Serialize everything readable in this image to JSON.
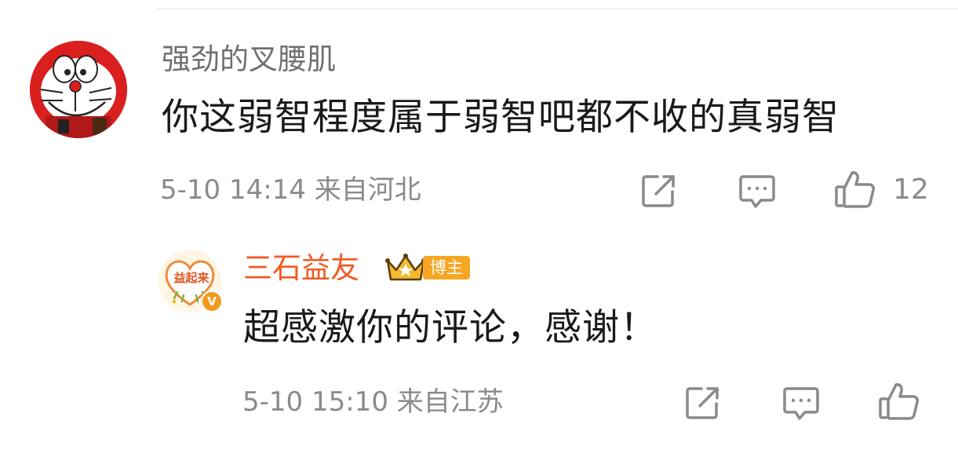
{
  "comment": {
    "username": "强劲的叉腰肌",
    "text": "你这弱智程度属于弱智吧都不收的真弱智",
    "time": "5-10 14:14",
    "location": "来自河北",
    "like_count": "12",
    "avatar_icon": "doraemon-avatar"
  },
  "reply": {
    "username": "三石益友",
    "badge_label": "博主",
    "badge_icon": "crown-icon",
    "avatar_text": "益起来",
    "avatar_verified_mark": "V",
    "text": "超感激你的评论，感谢！",
    "time": "5-10 15:10",
    "location": "来自江苏"
  },
  "icons": {
    "share": "share-icon",
    "comment": "comment-icon",
    "like": "thumbs-up-icon"
  },
  "colors": {
    "username_gray": "#707070",
    "body_text": "#1a1a1a",
    "meta_gray": "#8a8a8a",
    "blogger_orange": "#f15a22",
    "badge_orange": "#f5a623",
    "verified_orange": "#f29a1e"
  }
}
